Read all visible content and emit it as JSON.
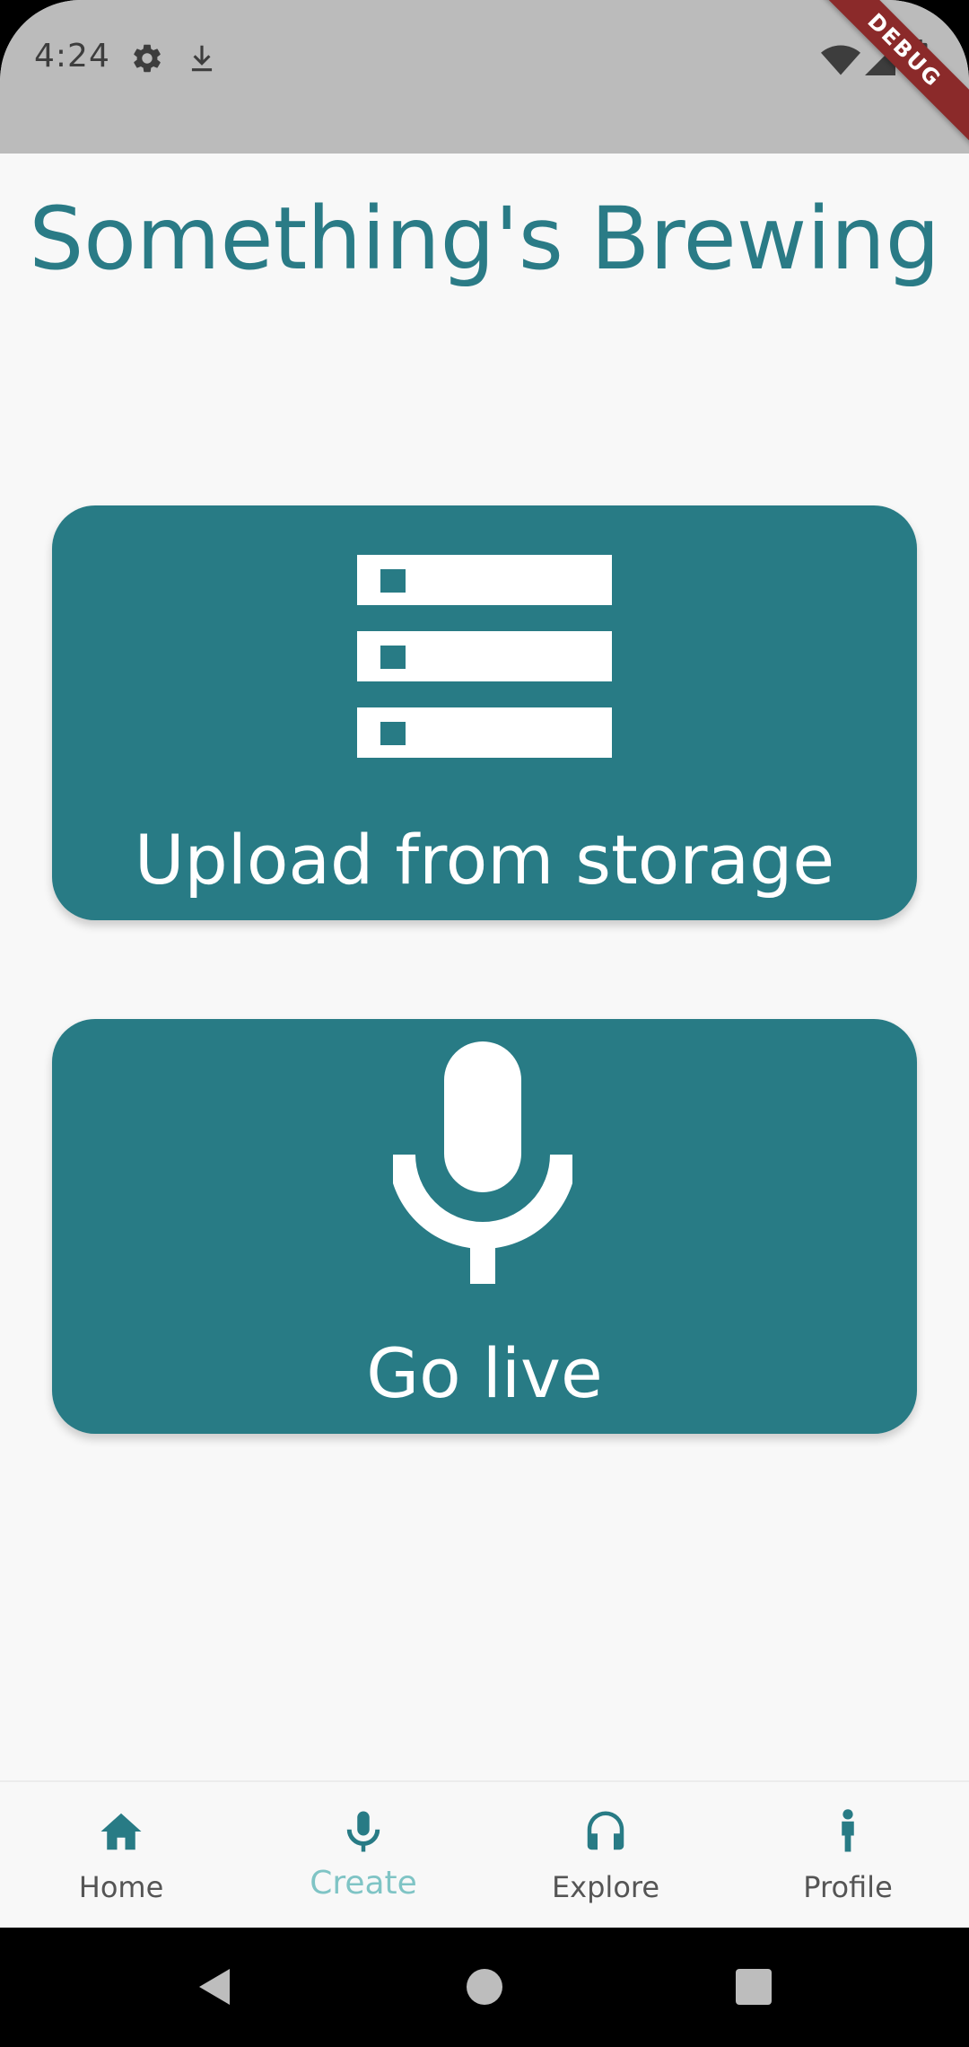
{
  "status_bar": {
    "time": "4:24",
    "icons": [
      "gear-icon",
      "download-icon",
      "wifi-icon",
      "signal-icon",
      "battery-icon"
    ],
    "debug_banner": "DEBUG"
  },
  "page": {
    "title": "Something's Brewing"
  },
  "cards": {
    "upload": {
      "label": "Upload from storage",
      "icon": "storage-icon"
    },
    "live": {
      "label": "Go live",
      "icon": "microphone-icon"
    }
  },
  "bottom_nav": {
    "items": [
      {
        "label": "Home",
        "icon": "home-icon",
        "active": false
      },
      {
        "label": "Create",
        "icon": "microphone-icon",
        "active": true
      },
      {
        "label": "Explore",
        "icon": "headphones-icon",
        "active": false
      },
      {
        "label": "Profile",
        "icon": "person-icon",
        "active": false
      }
    ]
  },
  "colors": {
    "accent": "#287b85",
    "title": "#2a7b86",
    "active_nav": "#7fc4c5",
    "status_bar": "#bbbbbb",
    "background": "#f8f8f8"
  }
}
